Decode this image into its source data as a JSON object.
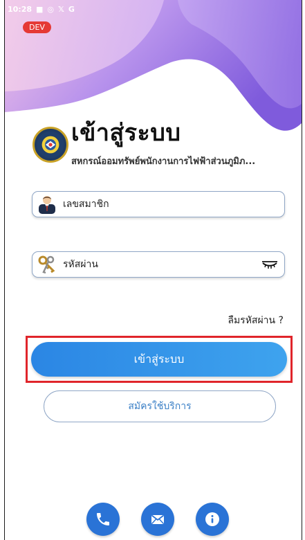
{
  "status_bar": {
    "time": "10:28",
    "icons": [
      "notification-icon",
      "instagram-icon",
      "x-icon",
      "g-icon"
    ]
  },
  "dev_badge": "DEV",
  "header": {
    "title": "เข้าสู่ระบบ",
    "subtitle": "สหกรณ์ออมทรัพย์พนักงานการไฟฟ้าส่วนภูมิภ..."
  },
  "form": {
    "member_placeholder": "เลขสมาชิก",
    "password_placeholder": "รหัสผ่าน",
    "forgot_password": "ลืมรหัสผ่าน ?"
  },
  "buttons": {
    "login": "เข้าสู่ระบบ",
    "register": "สมัครใช้บริการ"
  },
  "footer_actions": [
    "phone-icon",
    "mail-icon",
    "info-icon"
  ],
  "colors": {
    "primary": "#2a73d6",
    "login_gradient_start": "#2b86e4",
    "login_gradient_end": "#3ea3ee",
    "highlight": "#e0252b",
    "dev_badge": "#e53935",
    "wave_purple": "#8a5fe0",
    "wave_pink": "#e7a8e8"
  }
}
